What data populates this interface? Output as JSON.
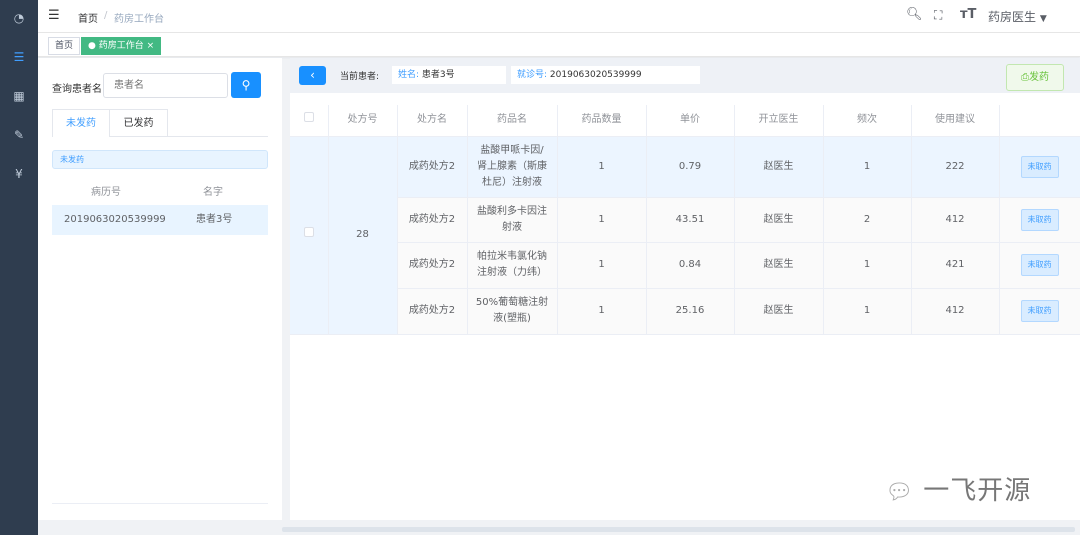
{
  "sidebar": {
    "icons": [
      "dashboard-icon",
      "list-icon",
      "table-icon",
      "edit-icon",
      "yen-icon"
    ],
    "active": 1
  },
  "header": {
    "breadcrumb": [
      "首页",
      "药房工作台"
    ],
    "separator": "/",
    "user": "药房医生"
  },
  "tags": [
    {
      "label": "首页"
    },
    {
      "label": "药房工作台",
      "close": "×",
      "active": true
    }
  ],
  "left": {
    "search_label": "查询患者名:",
    "search_placeholder": "患者名",
    "tabs": [
      "未发药",
      "已发药"
    ],
    "section": "未发药",
    "columns": [
      "病历号",
      "名字"
    ],
    "rows": [
      {
        "id": "2019063020539999",
        "name": "患者3号"
      }
    ]
  },
  "toolbar": {
    "back": "‹",
    "current_label": "当前患者:",
    "name_key": "姓名:",
    "name_value": "患者3号",
    "visit_key": "就诊号:",
    "visit_value": "2019063020539999",
    "dispense": "发药"
  },
  "table": {
    "columns": [
      "",
      "处方号",
      "处方名",
      "药品名",
      "药品数量",
      "单价",
      "开立医生",
      "频次",
      "使用建议",
      ""
    ],
    "prescription_no": "28",
    "rows": [
      {
        "rx": "成药处方2",
        "drug": "盐酸甲哌卡因/肾上腺素（斯康杜尼）注射液",
        "qty": "1",
        "price": "0.79",
        "doctor": "赵医生",
        "freq": "1",
        "advice": "222",
        "status": "未取药"
      },
      {
        "rx": "成药处方2",
        "drug": "盐酸利多卡因注射液",
        "qty": "1",
        "price": "43.51",
        "doctor": "赵医生",
        "freq": "2",
        "advice": "412",
        "status": "未取药"
      },
      {
        "rx": "成药处方2",
        "drug": "帕拉米韦氯化钠注射液（力纬）",
        "qty": "1",
        "price": "0.84",
        "doctor": "赵医生",
        "freq": "1",
        "advice": "421",
        "status": "未取药"
      },
      {
        "rx": "成药处方2",
        "drug": "50%葡萄糖注射液(塑瓶)",
        "qty": "1",
        "price": "25.16",
        "doctor": "赵医生",
        "freq": "1",
        "advice": "412",
        "status": "未取药"
      }
    ]
  },
  "watermark": "一飞开源",
  "colors": {
    "sidebar": "#2f3d4f",
    "primary": "#409eff",
    "tag_active": "#42b983",
    "success_light": "#f0f9eb"
  }
}
